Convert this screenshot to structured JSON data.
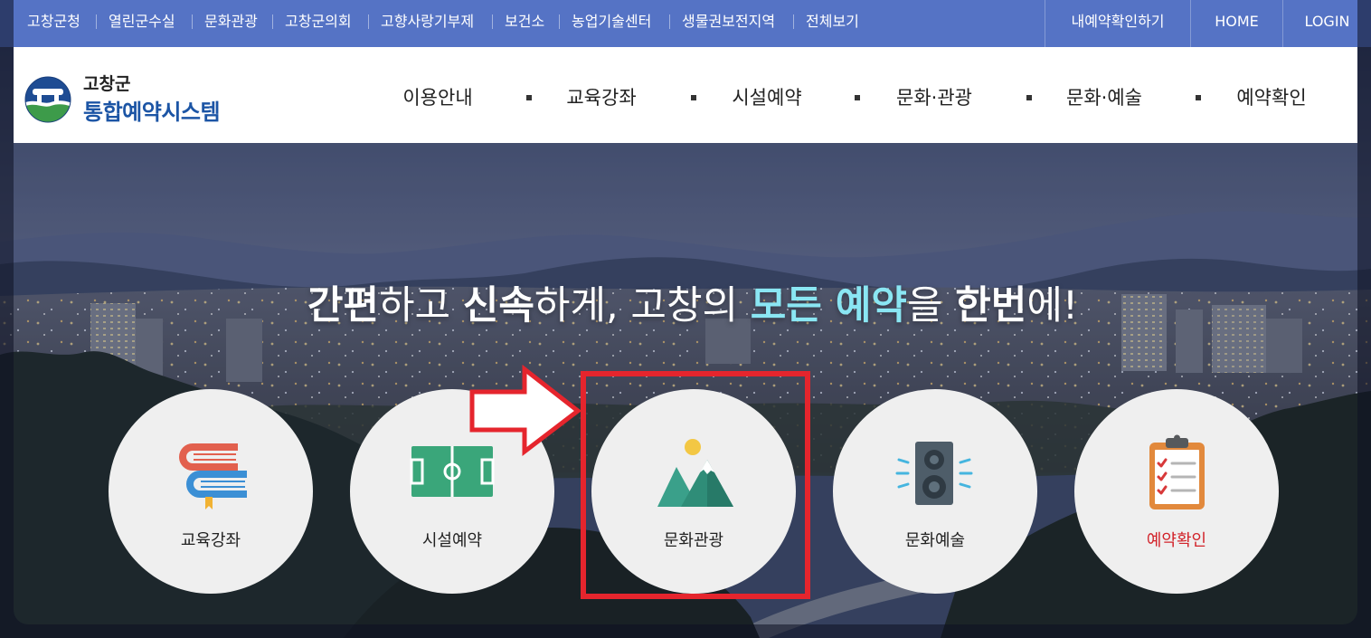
{
  "topbar": {
    "links": [
      "고창군청",
      "열린군수실",
      "문화관광",
      "고창군의회",
      "고향사랑기부제",
      "보건소",
      "농업기술센터",
      "생물권보전지역",
      "전체보기"
    ],
    "account_links": [
      "내예약확인하기",
      "HOME",
      "LOGIN"
    ]
  },
  "logo": {
    "org": "고창군",
    "system": "통합예약시스템",
    "icon": "county-emblem-icon"
  },
  "nav": {
    "items": [
      "이용안내",
      "교육강좌",
      "시설예약",
      "문화·관광",
      "문화·예술",
      "예약확인"
    ]
  },
  "hero": {
    "headline": [
      "간편",
      "하고 ",
      "신속",
      "하게, 고창의 ",
      "모든 예약",
      "을 ",
      "한번",
      "에!"
    ]
  },
  "services": [
    {
      "label": "교육강좌",
      "icon": "books-icon"
    },
    {
      "label": "시설예약",
      "icon": "sports-field-icon"
    },
    {
      "label": "문화관광",
      "icon": "mountain-sun-icon"
    },
    {
      "label": "문화예술",
      "icon": "speaker-icon"
    },
    {
      "label": "예약확인",
      "icon": "clipboard-checklist-icon"
    }
  ],
  "colors": {
    "topbar_bg": "#5573c5",
    "logo_text": "#1c55a5",
    "headline_accent": "#8ae6f3",
    "service_card_bg": "#efefef",
    "reservation_check_label": "#d2232a",
    "annotation_red": "#e5252d"
  }
}
